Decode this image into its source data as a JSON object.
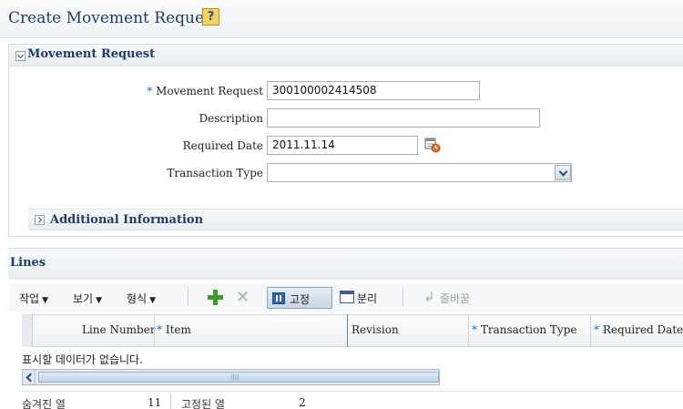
{
  "page": {
    "title": "Create Movement Request",
    "help_icon": "help-icon"
  },
  "movement_request": {
    "section_title": "Movement Request",
    "fields": {
      "movement_request": {
        "label": "Movement Request",
        "required": "*",
        "value": "300100002414508"
      },
      "description": {
        "label": "Description",
        "value": ""
      },
      "required_date": {
        "label": "Required Date",
        "value": "2011.11.14",
        "icon": "calendar-icon"
      },
      "transaction_type": {
        "label": "Transaction Type",
        "value": ""
      }
    }
  },
  "additional_information": {
    "section_title": "Additional Information"
  },
  "lines": {
    "section_title": "Lines",
    "toolbar": {
      "actions_menu": "작업",
      "view_menu": "보기",
      "format_menu": "형식",
      "add_icon": "plus-icon",
      "delete_icon": "delete-icon",
      "freeze_label": "고정",
      "detach_label": "분리",
      "wrap_label": "줄바꿈"
    },
    "columns": [
      {
        "label": "Line Number",
        "required": ""
      },
      {
        "label": "Item",
        "required": "*"
      },
      {
        "label": "Revision",
        "required": ""
      },
      {
        "label": "Transaction Type",
        "required": "*"
      },
      {
        "label": "Required Date",
        "required": "*"
      }
    ],
    "empty_message": "표시할 데이터가 없습니다.",
    "scroll_grip": "||||",
    "footer": {
      "hidden_columns_label": "숨겨진 열",
      "hidden_columns_value": "11",
      "frozen_columns_label": "고정된 열",
      "frozen_columns_value": "2"
    }
  },
  "colors": {
    "title_blue": "#1f3c66",
    "required_star": "#2a6ab1",
    "add_green": "#3a9b2a"
  }
}
